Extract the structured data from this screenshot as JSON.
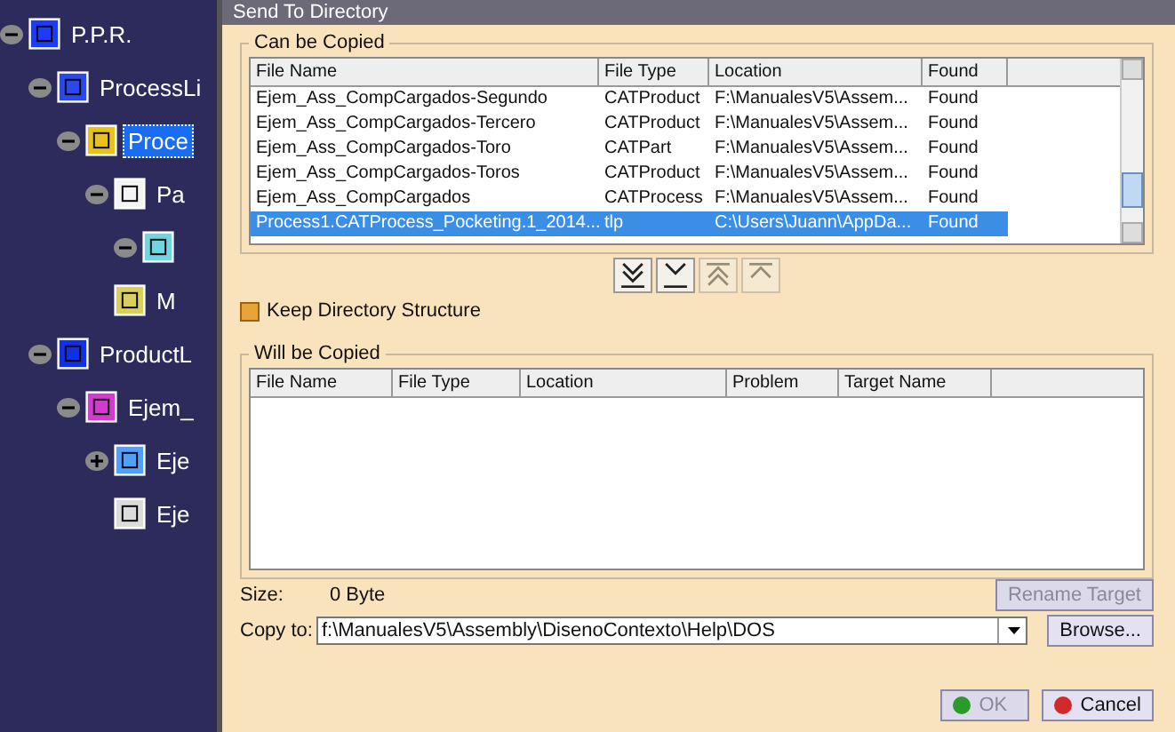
{
  "tree": [
    {
      "label": "P.P.R.",
      "kind": "ppr",
      "expanded": true,
      "selected": false,
      "children": [
        {
          "label": "ProcessLi",
          "kind": "list",
          "expanded": true,
          "selected": false,
          "children": [
            {
              "label": "Proce",
              "kind": "process",
              "expanded": true,
              "selected": true,
              "children": [
                {
                  "label": "Pa",
                  "kind": "machine",
                  "expanded": true,
                  "selected": false,
                  "children": [
                    {
                      "kind": "doc",
                      "expanded": true
                    }
                  ]
                },
                {
                  "label": "M",
                  "kind": "resource",
                  "selected": false
                }
              ]
            }
          ]
        },
        {
          "label": "ProductL",
          "kind": "product",
          "expanded": true,
          "selected": false,
          "children": [
            {
              "label": "Ejem_",
              "kind": "assembly",
              "expanded": true,
              "selected": false,
              "children": [
                {
                  "label": "Eje",
                  "kind": "part",
                  "expanded": false,
                  "selected": false
                },
                {
                  "label": "Eje",
                  "kind": "part2",
                  "selected": false
                }
              ]
            }
          ]
        }
      ]
    }
  ],
  "dialog": {
    "title": "Send To Directory",
    "can_be_copied": {
      "title": "Can be Copied",
      "columns": [
        "File Name",
        "File Type",
        "Location",
        "Found"
      ],
      "rows": [
        {
          "cells": [
            "Ejem_Ass_CompCargados-Segundo",
            "CATProduct",
            "F:\\ManualesV5\\Assem...",
            "Found"
          ],
          "selected": false
        },
        {
          "cells": [
            "Ejem_Ass_CompCargados-Tercero",
            "CATProduct",
            "F:\\ManualesV5\\Assem...",
            "Found"
          ],
          "selected": false
        },
        {
          "cells": [
            "Ejem_Ass_CompCargados-Toro",
            "CATPart",
            "F:\\ManualesV5\\Assem...",
            "Found"
          ],
          "selected": false
        },
        {
          "cells": [
            "Ejem_Ass_CompCargados-Toros",
            "CATProduct",
            "F:\\ManualesV5\\Assem...",
            "Found"
          ],
          "selected": false
        },
        {
          "cells": [
            "Ejem_Ass_CompCargados",
            "CATProcess",
            "F:\\ManualesV5\\Assem...",
            "Found"
          ],
          "selected": false
        },
        {
          "cells": [
            "Process1.CATProcess_Pocketing.1_2014...",
            "tlp",
            "C:\\Users\\Juann\\AppDa...",
            "Found"
          ],
          "selected": true
        }
      ]
    },
    "move_buttons": [
      {
        "kind": "all_down",
        "disabled": false
      },
      {
        "kind": "down",
        "disabled": false
      },
      {
        "kind": "all_up",
        "disabled": true
      },
      {
        "kind": "up",
        "disabled": true
      }
    ],
    "keep_structure": {
      "label": "Keep Directory Structure",
      "checked": false
    },
    "will_be_copied": {
      "title": "Will be Copied",
      "columns": [
        "File Name",
        "File Type",
        "Location",
        "Problem",
        "Target Name"
      ]
    },
    "size_label": "Size:",
    "size_value": "0 Byte",
    "rename_button": {
      "label": "Rename Target",
      "disabled": true
    },
    "copy_to_label": "Copy to:",
    "copy_to_value": "f:\\ManualesV5\\Assembly\\DisenoContexto\\Help\\DOS",
    "browse_button": {
      "label": "Browse...",
      "disabled": false
    },
    "ok_button": {
      "label": "OK",
      "disabled": true
    },
    "cancel_button": {
      "label": "Cancel",
      "disabled": false
    }
  }
}
